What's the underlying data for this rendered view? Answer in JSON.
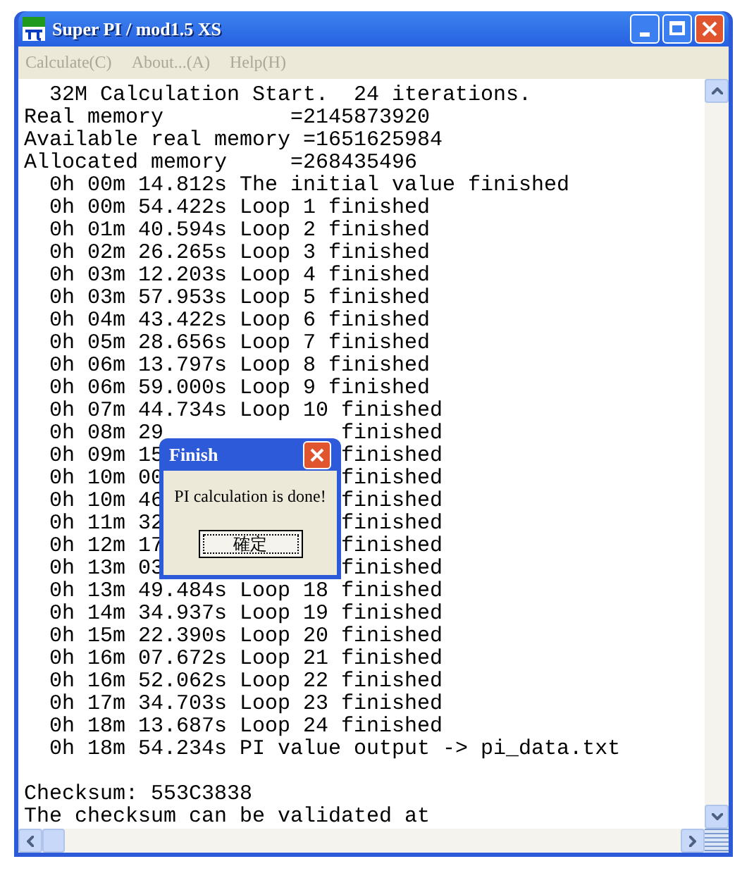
{
  "window": {
    "title": "Super PI / mod1.5 XS"
  },
  "menu": [
    {
      "label": "Calculate(C)",
      "disabled": true
    },
    {
      "label": "About...(A)",
      "disabled": true
    },
    {
      "label": "Help(H)",
      "disabled": true
    }
  ],
  "output_lines": [
    {
      "text": "  32M Calculation Start.  24 iterations."
    },
    {
      "text": "Real memory          =2145873920"
    },
    {
      "text": "Available real memory =1651625984"
    },
    {
      "text": "Allocated memory     =268435496"
    },
    {
      "text": "  0h 00m 14.812s The initial value finished"
    },
    {
      "text": "  0h 00m 54.422s Loop 1 finished"
    },
    {
      "text": "  0h 01m 40.594s Loop 2 finished"
    },
    {
      "text": "  0h 02m 26.265s Loop 3 finished"
    },
    {
      "text": "  0h 03m 12.203s Loop 4 finished"
    },
    {
      "text": "  0h 03m 57.953s Loop 5 finished"
    },
    {
      "text": "  0h 04m 43.422s Loop 6 finished"
    },
    {
      "text": "  0h 05m 28.656s Loop 7 finished"
    },
    {
      "text": "  0h 06m 13.797s Loop 8 finished"
    },
    {
      "text": "  0h 06m 59.000s Loop 9 finished"
    },
    {
      "text": "  0h 07m 44.734s Loop 10 finished"
    },
    {
      "text": "  0h 08m 29",
      "tail": "finished"
    },
    {
      "text": "  0h 09m 15",
      "tail": "finished"
    },
    {
      "text": "  0h 10m 00",
      "tail": "finished"
    },
    {
      "text": "  0h 10m 46",
      "tail": "finished"
    },
    {
      "text": "  0h 11m 32",
      "tail": "finished"
    },
    {
      "text": "  0h 12m 17",
      "tail": "finished"
    },
    {
      "text": "  0h 13m 03",
      "tail": "finished"
    },
    {
      "text": "  0h 13m 49.484s Loop 18 finished"
    },
    {
      "text": "  0h 14m 34.937s Loop 19 finished"
    },
    {
      "text": "  0h 15m 22.390s Loop 20 finished"
    },
    {
      "text": "  0h 16m 07.672s Loop 21 finished"
    },
    {
      "text": "  0h 16m 52.062s Loop 22 finished"
    },
    {
      "text": "  0h 17m 34.703s Loop 23 finished"
    },
    {
      "text": "  0h 18m 13.687s Loop 24 finished"
    },
    {
      "text": "  0h 18m 54.234s PI value output -> pi_data.txt"
    },
    {
      "text": "Checksum: 553C3838",
      "gap_before": true
    },
    {
      "text": "The checksum can be validated at"
    }
  ],
  "dialog": {
    "title": "Finish",
    "message": "PI calculation is done!",
    "button": "確定"
  }
}
